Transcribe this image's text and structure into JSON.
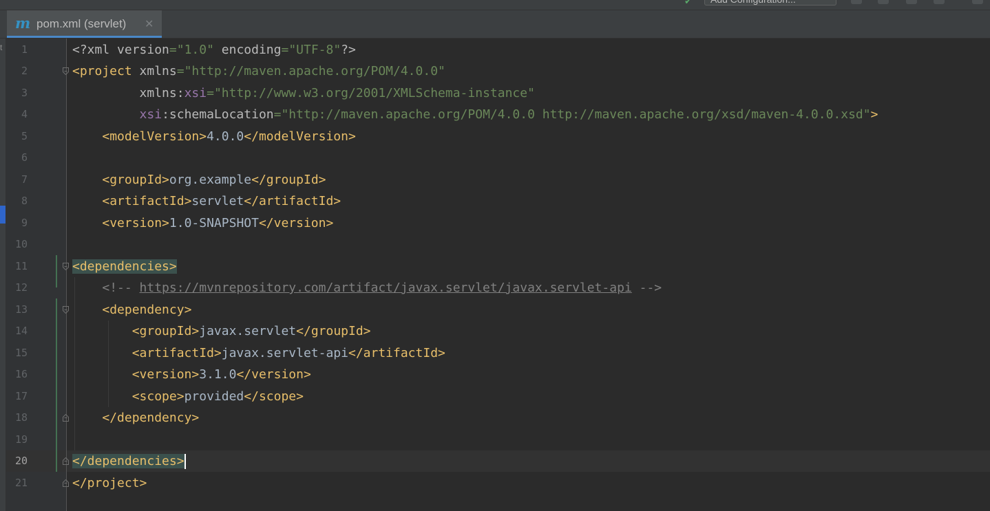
{
  "toolbar": {
    "add_configuration_label": "Add Configuration..."
  },
  "tab": {
    "icon_letter": "m",
    "label": "pom.xml (servlet)",
    "close_glyph": "✕"
  },
  "editor": {
    "current_line": 20,
    "lines": [
      {
        "n": "1"
      },
      {
        "n": "2"
      },
      {
        "n": "3"
      },
      {
        "n": "4"
      },
      {
        "n": "5"
      },
      {
        "n": "6"
      },
      {
        "n": "7"
      },
      {
        "n": "8"
      },
      {
        "n": "9"
      },
      {
        "n": "10"
      },
      {
        "n": "11"
      },
      {
        "n": "12"
      },
      {
        "n": "13"
      },
      {
        "n": "14"
      },
      {
        "n": "15"
      },
      {
        "n": "16"
      },
      {
        "n": "17"
      },
      {
        "n": "18"
      },
      {
        "n": "19"
      },
      {
        "n": "20"
      },
      {
        "n": "21"
      }
    ],
    "code": {
      "l1": {
        "decl_open": "<?xml ",
        "version_attr": "version",
        "version_val": "\"1.0\"",
        "encoding_attr": "encoding",
        "encoding_val": "\"UTF-8\"",
        "decl_close": "?>"
      },
      "l2": {
        "open": "<project ",
        "attr": "xmlns",
        "val": "\"http://maven.apache.org/POM/4.0.0\""
      },
      "l3": {
        "attr_prefix": "xmlns:",
        "attr_ns": "xsi",
        "val": "\"http://www.w3.org/2001/XMLSchema-instance\""
      },
      "l4": {
        "attr_ns": "xsi",
        "attr_local": ":schemaLocation",
        "val": "\"http://maven.apache.org/POM/4.0.0 http://maven.apache.org/xsd/maven-4.0.0.xsd\"",
        "close": ">"
      },
      "l5": {
        "open": "<modelVersion>",
        "text": "4.0.0",
        "close": "</modelVersion>"
      },
      "l7": {
        "open": "<groupId>",
        "text": "org.example",
        "close": "</groupId>"
      },
      "l8": {
        "open": "<artifactId>",
        "text": "servlet",
        "close": "</artifactId>"
      },
      "l9": {
        "open": "<version>",
        "text": "1.0-SNAPSHOT",
        "close": "</version>"
      },
      "l11": {
        "open": "<dependencies>"
      },
      "l12": {
        "comment_open": "<!-- ",
        "url": "https://mvnrepository.com/artifact/javax.servlet/javax.servlet-api",
        "comment_close": " -->"
      },
      "l13": {
        "open": "<dependency>"
      },
      "l14": {
        "open": "<groupId>",
        "text": "javax.servlet",
        "close": "</groupId>"
      },
      "l15": {
        "open": "<artifactId>",
        "text": "javax.servlet-api",
        "close": "</artifactId>"
      },
      "l16": {
        "open": "<version>",
        "text": "3.1.0",
        "close": "</version>"
      },
      "l17": {
        "open": "<scope>",
        "text": "provided",
        "close": "</scope>"
      },
      "l18": {
        "close": "</dependency>"
      },
      "l20": {
        "close": "</dependencies>"
      },
      "l21": {
        "close": "</project>"
      }
    }
  },
  "colors": {
    "background": "#2b2b2b",
    "tag": "#e8bf6a",
    "string": "#6a8759",
    "comment": "#808080",
    "namespace": "#9876aa",
    "tab_underline": "#4a88c7"
  }
}
